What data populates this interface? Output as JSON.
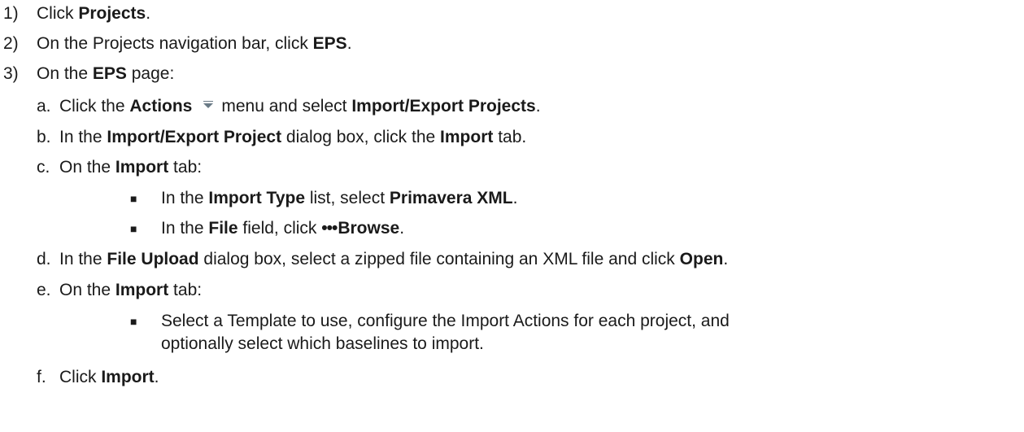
{
  "steps": [
    {
      "num": "1)",
      "parts": [
        "Click ",
        "Projects",
        "."
      ]
    },
    {
      "num": "2)",
      "parts": [
        "On the Projects navigation bar, click ",
        "EPS",
        "."
      ]
    },
    {
      "num": "3)",
      "parts": [
        "On the ",
        "EPS",
        " page:"
      ]
    }
  ],
  "substeps": {
    "a": {
      "letter": "a.",
      "t1": "Click the ",
      "b1": "Actions",
      "t2": "menu and select ",
      "b2": "Import/Export Projects",
      "t3": "."
    },
    "b": {
      "letter": "b.",
      "t1": "In the ",
      "b1": "Import/Export Project",
      "t2": " dialog box, click the ",
      "b2": "Import",
      "t3": " tab."
    },
    "c": {
      "letter": "c.",
      "t1": "On the ",
      "b1": "Import",
      "t2": " tab:"
    },
    "c_bullets": [
      {
        "t1": "In the ",
        "b1": "Import Type",
        "t2": " list, select ",
        "b2": "Primavera XML",
        "t3": "."
      },
      {
        "t1": "In the ",
        "b1": "File",
        "t2": " field, click ",
        "dots": "•••",
        "b2": "Browse",
        "t3": "."
      }
    ],
    "d": {
      "letter": "d.",
      "t1": "In the ",
      "b1": "File Upload",
      "t2": " dialog box, select a zipped file containing an XML file and click ",
      "b2": "Open",
      "t3": "."
    },
    "e": {
      "letter": "e.",
      "t1": "On the ",
      "b1": "Import",
      "t2": " tab:"
    },
    "e_bullet": {
      "line1": "Select a Template to use, configure the Import Actions for each project, and",
      "line2": "optionally select which baselines to import."
    },
    "f": {
      "letter": "f.",
      "t1": "Click ",
      "b1": "Import",
      "t2": "."
    }
  },
  "bullet_glyph": "■",
  "icons": {
    "actions_menu": "dropdown-caret-icon"
  },
  "colors": {
    "text": "#1a1a1a",
    "caret": "#6a7a86"
  }
}
